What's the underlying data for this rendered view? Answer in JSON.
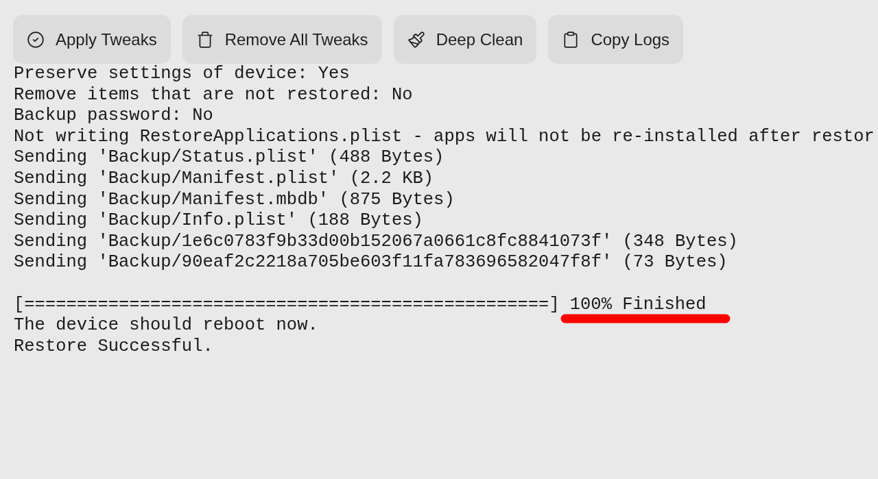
{
  "toolbar": [
    {
      "kind": "check",
      "label": "Apply Tweaks"
    },
    {
      "kind": "trash",
      "label": "Remove All Tweaks"
    },
    {
      "kind": "brush",
      "label": "Deep Clean"
    },
    {
      "kind": "clipboard",
      "label": "Copy Logs"
    }
  ],
  "log": [
    {
      "kind": "text",
      "text": "Preserve settings of device: Yes"
    },
    {
      "kind": "text",
      "text": "Remove items that are not restored: No"
    },
    {
      "kind": "text",
      "text": "Backup password: No"
    },
    {
      "kind": "text",
      "text": "Not writing RestoreApplications.plist - apps will not be re-installed after restor"
    },
    {
      "kind": "text",
      "text": "Sending 'Backup/Status.plist' (488 Bytes)"
    },
    {
      "kind": "text",
      "text": "Sending 'Backup/Manifest.plist' (2.2 KB)"
    },
    {
      "kind": "text",
      "text": "Sending 'Backup/Manifest.mbdb' (875 Bytes)"
    },
    {
      "kind": "text",
      "text": "Sending 'Backup/Info.plist' (188 Bytes)"
    },
    {
      "kind": "text",
      "text": "Sending 'Backup/1e6c0783f9b33d00b152067a0661c8fc8841073f' (348 Bytes)"
    },
    {
      "kind": "text",
      "text": "Sending 'Backup/90eaf2c2218a705be603f11fa783696582047f8f' (73 Bytes)"
    },
    {
      "kind": "progress",
      "bar": "[==================================================]",
      "status": "100% Finished",
      "underlined": true
    },
    {
      "kind": "text",
      "text": "The device should reboot now."
    },
    {
      "kind": "text",
      "text": "Restore Successful."
    }
  ]
}
